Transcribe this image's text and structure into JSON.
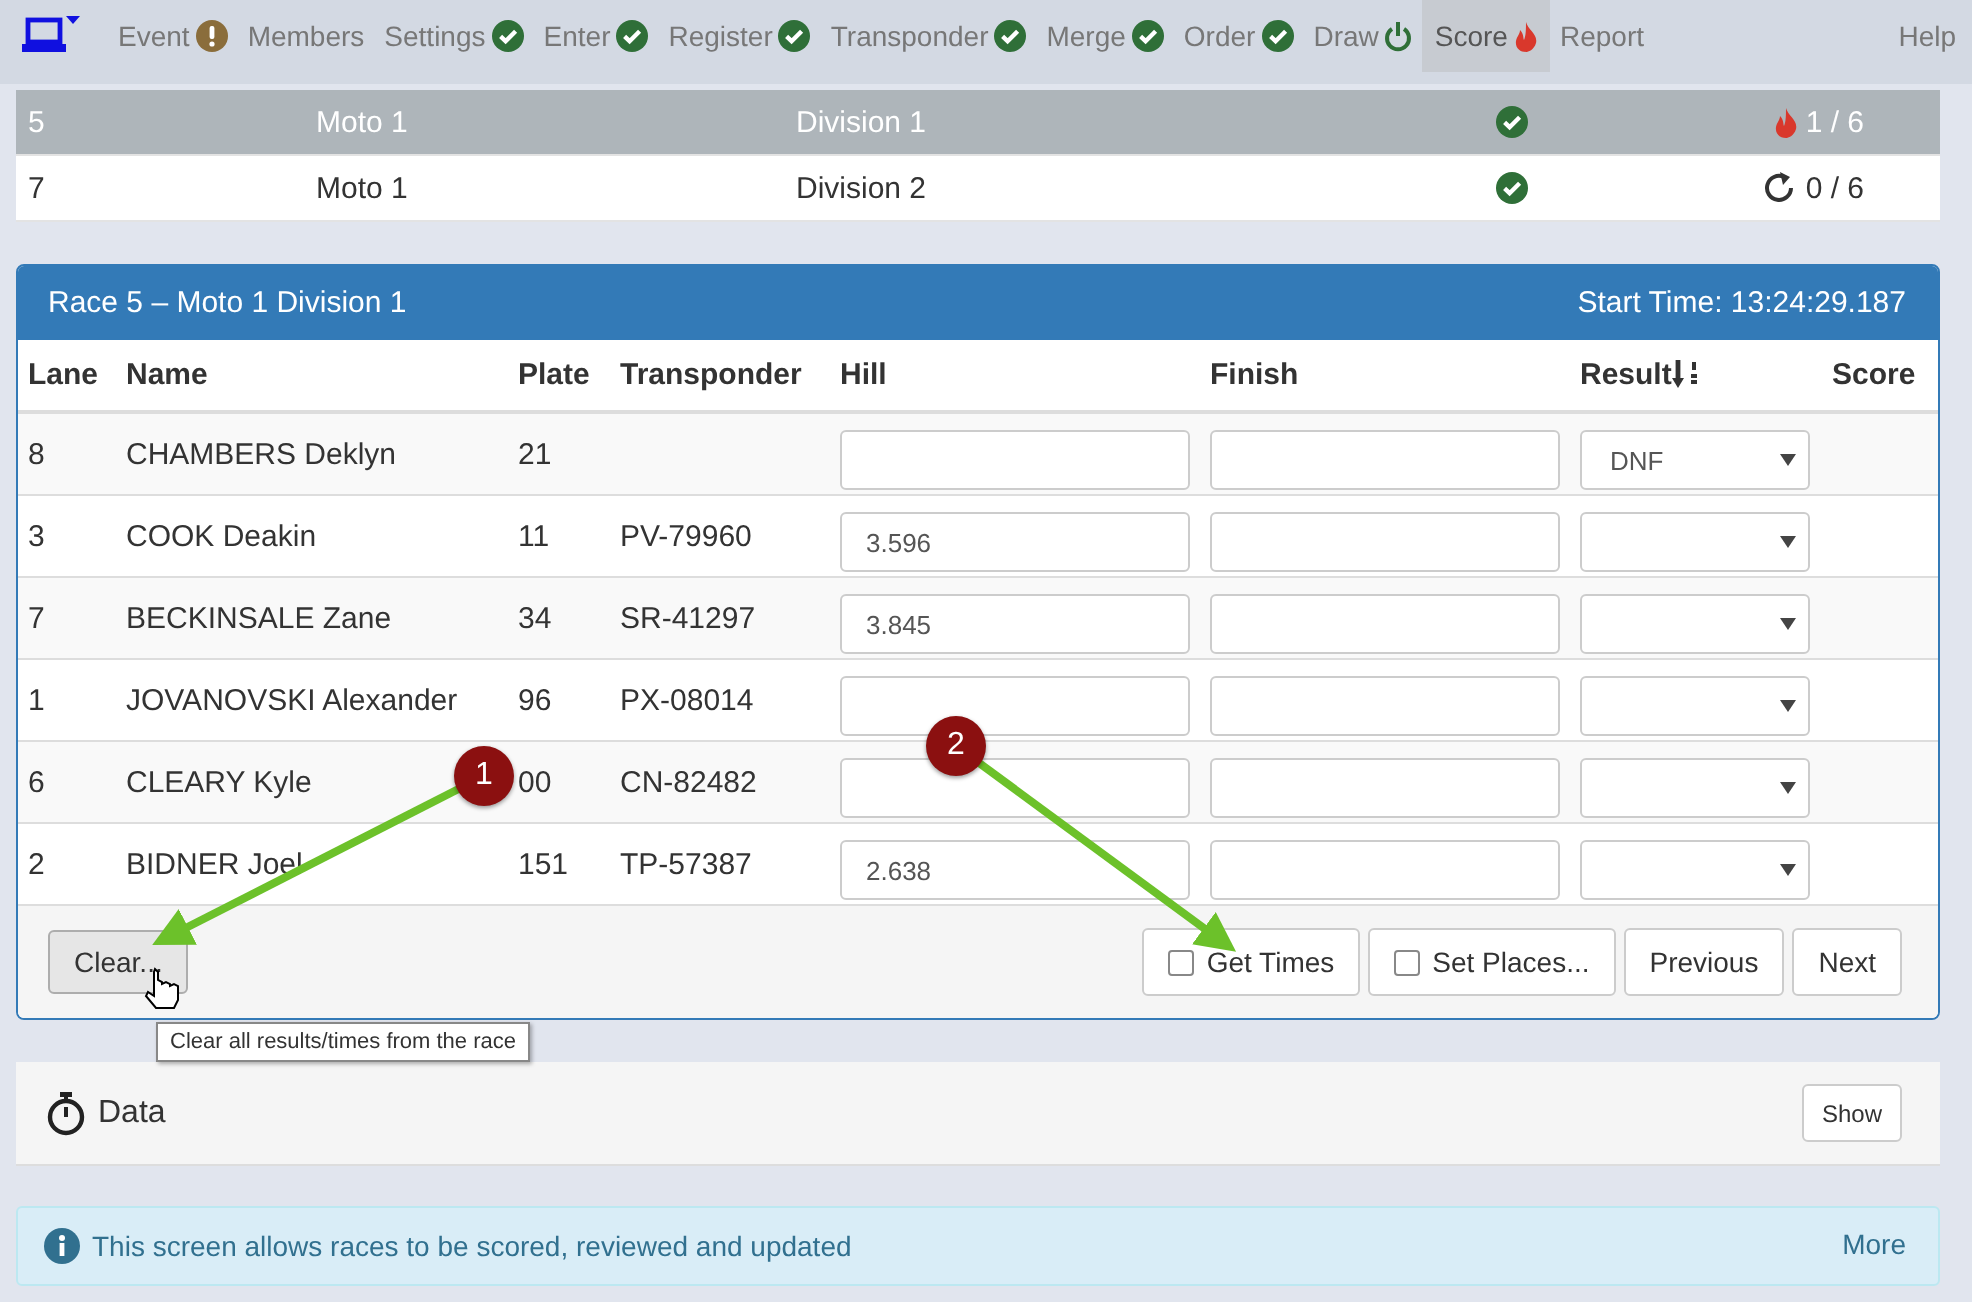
{
  "nav": {
    "items": [
      {
        "label": "Event",
        "kind": "warning",
        "selected": false
      },
      {
        "label": "Members",
        "kind": "plain",
        "selected": false
      },
      {
        "label": "Settings",
        "kind": "check",
        "selected": false
      },
      {
        "label": "Enter",
        "kind": "check",
        "selected": false
      },
      {
        "label": "Register",
        "kind": "check",
        "selected": false
      },
      {
        "label": "Transponder",
        "kind": "check",
        "selected": false
      },
      {
        "label": "Merge",
        "kind": "check",
        "selected": false
      },
      {
        "label": "Order",
        "kind": "check",
        "selected": false
      },
      {
        "label": "Draw",
        "kind": "power",
        "selected": false
      },
      {
        "label": "Score",
        "kind": "fire",
        "selected": true
      },
      {
        "label": "Report",
        "kind": "plain",
        "selected": false
      }
    ],
    "help": "Help"
  },
  "race_list": [
    {
      "race": "5",
      "moto": "Moto 1",
      "division": "Division 1",
      "done": true,
      "progress": {
        "text": "1 / 6",
        "kind": "fire"
      },
      "selected": true
    },
    {
      "race": "7",
      "moto": "Moto 1",
      "division": "Division 2",
      "done": true,
      "progress": {
        "text": "0 / 6",
        "kind": "refresh"
      },
      "selected": false
    }
  ],
  "panel": {
    "title": "Race 5 – Moto 1 Division 1",
    "start_time": "Start Time: 13:24:29.187",
    "columns": [
      {
        "label": "Lane",
        "sorted": false
      },
      {
        "label": "Name",
        "sorted": false
      },
      {
        "label": "Plate",
        "sorted": false
      },
      {
        "label": "Transponder",
        "sorted": false
      },
      {
        "label": "Hill",
        "sorted": false
      },
      {
        "label": "Finish",
        "sorted": false
      },
      {
        "label": "Result",
        "sorted": true
      },
      {
        "label": "Score",
        "sorted": false
      }
    ],
    "rows": [
      {
        "lane": "8",
        "name": "CHAMBERS Deklyn",
        "plate": "21",
        "result": "DNF"
      },
      {
        "lane": "3",
        "name": "COOK Deakin",
        "plate": "11",
        "transponder": "PV-79960",
        "hill": "3.596"
      },
      {
        "lane": "7",
        "name": "BECKINSALE Zane",
        "plate": "34",
        "transponder": "SR-41297",
        "hill": "3.845"
      },
      {
        "lane": "1",
        "name": "JOVANOVSKI Alexander",
        "plate": "96",
        "transponder": "PX-08014"
      },
      {
        "lane": "6",
        "name": "CLEARY Kyle",
        "plate": "00",
        "transponder": "CN-82482"
      },
      {
        "lane": "2",
        "name": "BIDNER Joel",
        "plate": "151",
        "transponder": "TP-57387",
        "hill": "2.638"
      }
    ],
    "clear": "Clear...",
    "actions": [
      {
        "label": "Get Times",
        "kind": "checkbox",
        "checked": false
      },
      {
        "label": "Set Places...",
        "kind": "checkbox",
        "checked": false
      },
      {
        "label": "Previous",
        "kind": "button"
      },
      {
        "label": "Next",
        "kind": "button"
      }
    ]
  },
  "tooltip": "Clear all results/times from the race",
  "data_panel": {
    "title": "Data",
    "button": "Show"
  },
  "info": {
    "text": "This screen allows races to be scored, reviewed and updated",
    "link": "More"
  },
  "callouts": [
    {
      "number": "1"
    },
    {
      "number": "2"
    }
  ]
}
